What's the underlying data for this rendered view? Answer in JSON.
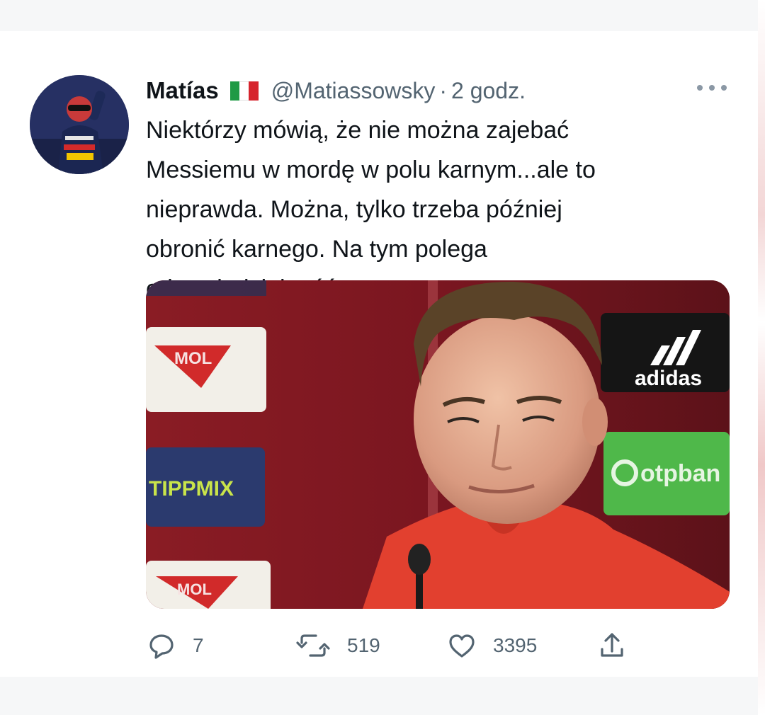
{
  "tweet": {
    "author": {
      "name": "Matías",
      "flag_icon": "italy-flag-icon",
      "handle": "@Matiassowsky",
      "separator": "·",
      "time": "2 godz.",
      "avatar_icon": "racing-driver-avatar"
    },
    "more_icon": "more-dots-icon",
    "text_lines": [
      "Niektórzy mówią, że nie można zajebać",
      "Messiemu w mordę w polu karnym...ale to",
      "nieprawda. Można, tylko trzeba później",
      "obronić karnego. Na tym polega",
      "odpowiedzialność..."
    ],
    "media": {
      "description_icon": "press-conference-photo",
      "sponsor_logos": [
        "MOL",
        "TIPPMIX",
        "adidas",
        "otpbank",
        "MOL"
      ]
    },
    "actions": {
      "reply": {
        "icon": "reply-icon",
        "count": "7"
      },
      "retweet": {
        "icon": "retweet-icon",
        "count": "519"
      },
      "like": {
        "icon": "heart-icon",
        "count": "3395"
      },
      "share": {
        "icon": "share-icon"
      }
    }
  },
  "colors": {
    "text_primary": "#0f1419",
    "text_secondary": "#536471",
    "background": "#f6f7f8",
    "card": "#ffffff"
  }
}
